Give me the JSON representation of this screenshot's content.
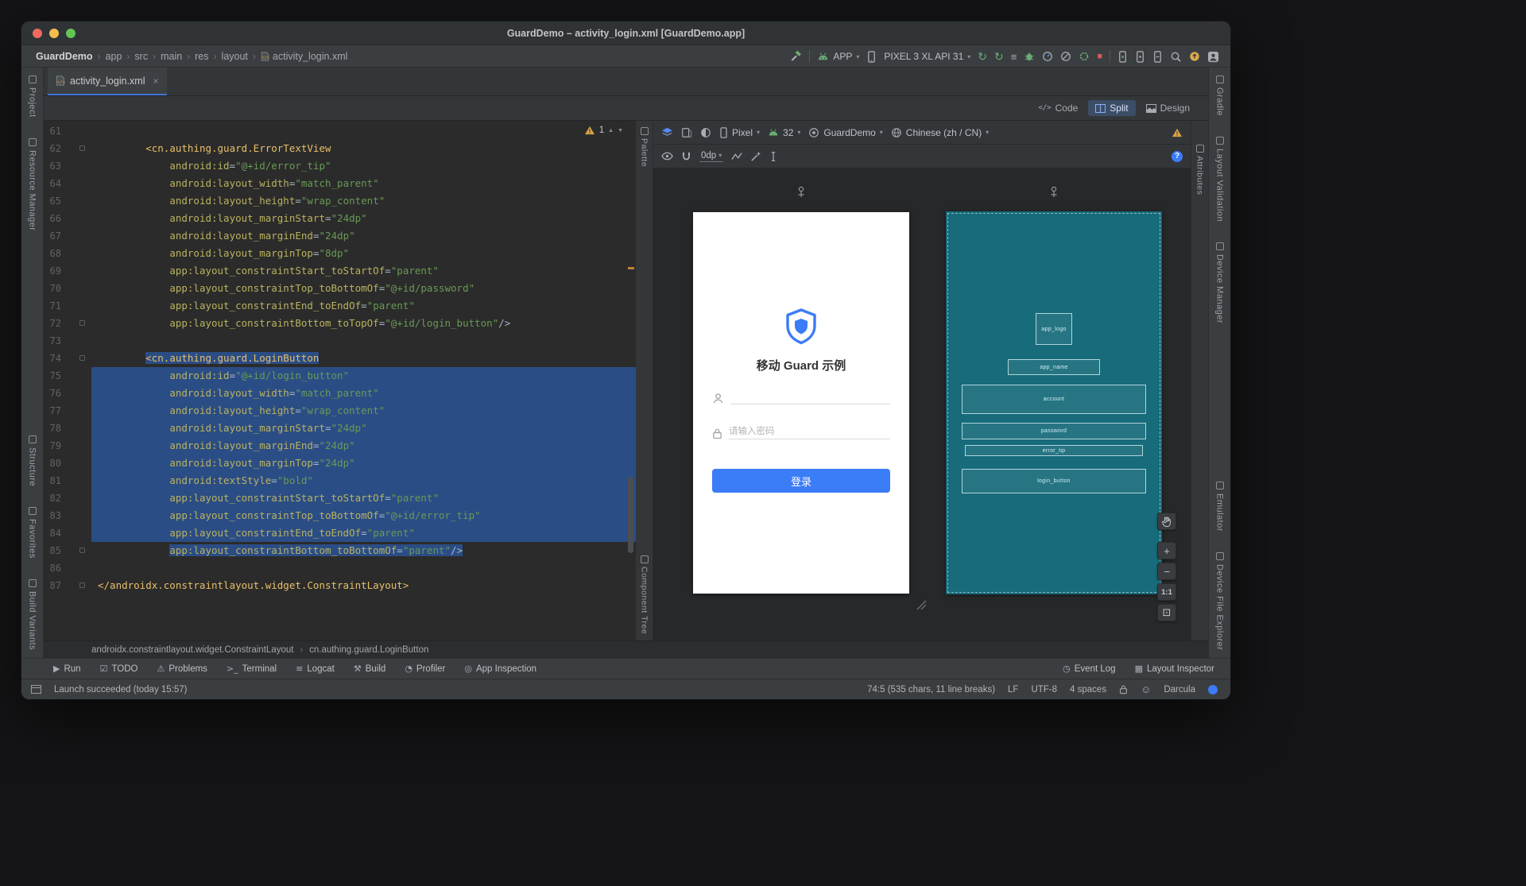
{
  "window": {
    "title": "GuardDemo – activity_login.xml [GuardDemo.app]"
  },
  "nav_breadcrumb": {
    "items": [
      "GuardDemo",
      "app",
      "src",
      "main",
      "res",
      "layout",
      "activity_login.xml"
    ]
  },
  "run_toolbar": {
    "config_label": "APP",
    "device_label": "PIXEL 3 XL API 31"
  },
  "left_stripe": {
    "top": [
      "Project",
      "Resource Manager"
    ],
    "bottom": [
      "Structure",
      "Favorites",
      "Build Variants"
    ]
  },
  "right_stripe": {
    "top": [
      "Gradle",
      "Layout Validation",
      "Device Manager"
    ],
    "bottom": [
      "Emulator",
      "Device File Explorer"
    ]
  },
  "editor": {
    "tab_title": "activity_login.xml",
    "modes": [
      "Code",
      "Split",
      "Design"
    ],
    "active_mode": "Split",
    "warning_count": "1"
  },
  "code": {
    "lines": [
      {
        "n": 61
      },
      {
        "n": 62,
        "ind": "        ",
        "m": 1,
        "seg": [
          [
            "t",
            "<cn.authing.guard.ErrorTextView"
          ]
        ]
      },
      {
        "n": 63,
        "ind": "            ",
        "seg": [
          [
            "a",
            "android:id"
          ],
          [
            "p",
            "="
          ],
          [
            "s",
            "\"@+id/error_tip\""
          ]
        ]
      },
      {
        "n": 64,
        "ind": "            ",
        "seg": [
          [
            "a",
            "android:layout_width"
          ],
          [
            "p",
            "="
          ],
          [
            "s",
            "\"match_parent\""
          ]
        ]
      },
      {
        "n": 65,
        "ind": "            ",
        "seg": [
          [
            "a",
            "android:layout_height"
          ],
          [
            "p",
            "="
          ],
          [
            "s",
            "\"wrap_content\""
          ]
        ]
      },
      {
        "n": 66,
        "ind": "            ",
        "seg": [
          [
            "a",
            "android:layout_marginStart"
          ],
          [
            "p",
            "="
          ],
          [
            "s",
            "\"24dp\""
          ]
        ]
      },
      {
        "n": 67,
        "ind": "            ",
        "seg": [
          [
            "a",
            "android:layout_marginEnd"
          ],
          [
            "p",
            "="
          ],
          [
            "s",
            "\"24dp\""
          ]
        ]
      },
      {
        "n": 68,
        "ind": "            ",
        "seg": [
          [
            "a",
            "android:layout_marginTop"
          ],
          [
            "p",
            "="
          ],
          [
            "s",
            "\"8dp\""
          ]
        ]
      },
      {
        "n": 69,
        "ind": "            ",
        "seg": [
          [
            "a",
            "app:layout_constraintStart_toStartOf"
          ],
          [
            "p",
            "="
          ],
          [
            "s",
            "\"parent\""
          ]
        ]
      },
      {
        "n": 70,
        "ind": "            ",
        "seg": [
          [
            "a",
            "app:layout_constraintTop_toBottomOf"
          ],
          [
            "p",
            "="
          ],
          [
            "s",
            "\"@+id/password\""
          ]
        ]
      },
      {
        "n": 71,
        "ind": "            ",
        "seg": [
          [
            "a",
            "app:layout_constraintEnd_toEndOf"
          ],
          [
            "p",
            "="
          ],
          [
            "s",
            "\"parent\""
          ]
        ]
      },
      {
        "n": 72,
        "ind": "            ",
        "m": 1,
        "seg": [
          [
            "a",
            "app:layout_constraintBottom_toTopOf"
          ],
          [
            "p",
            "="
          ],
          [
            "s",
            "\"@+id/login_button\""
          ],
          [
            "p",
            "/>"
          ]
        ]
      },
      {
        "n": 73
      },
      {
        "n": 74,
        "ind": "        ",
        "sel": "text",
        "m": 1,
        "seg": [
          [
            "t",
            "<cn.authing.guard.LoginButton"
          ]
        ]
      },
      {
        "n": 75,
        "ind": "            ",
        "sel": "full",
        "seg": [
          [
            "a",
            "android:id"
          ],
          [
            "p",
            "="
          ],
          [
            "s",
            "\"@+id/login_button\""
          ]
        ]
      },
      {
        "n": 76,
        "ind": "            ",
        "sel": "full",
        "seg": [
          [
            "a",
            "android:layout_width"
          ],
          [
            "p",
            "="
          ],
          [
            "s",
            "\"match_parent\""
          ]
        ]
      },
      {
        "n": 77,
        "ind": "            ",
        "sel": "full",
        "seg": [
          [
            "a",
            "android:layout_height"
          ],
          [
            "p",
            "="
          ],
          [
            "s",
            "\"wrap_content\""
          ]
        ]
      },
      {
        "n": 78,
        "ind": "            ",
        "sel": "full",
        "seg": [
          [
            "a",
            "android:layout_marginStart"
          ],
          [
            "p",
            "="
          ],
          [
            "s",
            "\"24dp\""
          ]
        ]
      },
      {
        "n": 79,
        "ind": "            ",
        "sel": "full",
        "seg": [
          [
            "a",
            "android:layout_marginEnd"
          ],
          [
            "p",
            "="
          ],
          [
            "s",
            "\"24dp\""
          ]
        ]
      },
      {
        "n": 80,
        "ind": "            ",
        "sel": "full",
        "seg": [
          [
            "a",
            "android:layout_marginTop"
          ],
          [
            "p",
            "="
          ],
          [
            "s",
            "\"24dp\""
          ]
        ]
      },
      {
        "n": 81,
        "ind": "            ",
        "sel": "full",
        "seg": [
          [
            "a",
            "android:textStyle"
          ],
          [
            "p",
            "="
          ],
          [
            "s",
            "\"bold\""
          ]
        ]
      },
      {
        "n": 82,
        "ind": "            ",
        "sel": "full",
        "seg": [
          [
            "a",
            "app:layout_constraintStart_toStartOf"
          ],
          [
            "p",
            "="
          ],
          [
            "s",
            "\"parent\""
          ]
        ]
      },
      {
        "n": 83,
        "ind": "            ",
        "sel": "full",
        "seg": [
          [
            "a",
            "app:layout_constraintTop_toBottomOf"
          ],
          [
            "p",
            "="
          ],
          [
            "s",
            "\"@+id/error_tip\""
          ]
        ]
      },
      {
        "n": 84,
        "ind": "            ",
        "sel": "full",
        "seg": [
          [
            "a",
            "app:layout_constraintEnd_toEndOf"
          ],
          [
            "p",
            "="
          ],
          [
            "s",
            "\"parent\""
          ]
        ]
      },
      {
        "n": 85,
        "ind": "            ",
        "sel": "text",
        "m": 1,
        "seg": [
          [
            "a",
            "app:layout_constraintBottom_toBottomOf"
          ],
          [
            "p",
            "="
          ],
          [
            "s",
            "\"parent\""
          ],
          [
            "p",
            "/>"
          ]
        ]
      },
      {
        "n": 86
      },
      {
        "n": 87,
        "m": 1,
        "seg": [
          [
            "t",
            "</androidx.constraintlayout.widget.ConstraintLayout>"
          ]
        ]
      }
    ]
  },
  "design_toolbar": {
    "device": "Pixel",
    "api": "32",
    "theme": "GuardDemo",
    "locale": "Chinese (zh / CN)",
    "margin": "0dp"
  },
  "design_tabs": {
    "palette": "Palette",
    "component_tree": "Component Tree",
    "attributes": "Attributes"
  },
  "preview": {
    "app_title": "移动 Guard 示例",
    "password_placeholder": "请输入密码",
    "login_button": "登录",
    "accent_color": "#3b7cf7"
  },
  "blueprint": {
    "labels": [
      "app_logo",
      "app_name",
      "account",
      "password",
      "error_tip",
      "login_button"
    ]
  },
  "zoom_controls": {
    "scale_label": "1:1"
  },
  "xml_breadcrumb": {
    "items": [
      "androidx.constraintlayout.widget.ConstraintLayout",
      "cn.authing.guard.LoginButton"
    ]
  },
  "bottom_bar": {
    "left": [
      {
        "label": "Run",
        "icon": "run-icon",
        "glyph": "▶"
      },
      {
        "label": "TODO",
        "icon": "todo-icon",
        "glyph": "☑"
      },
      {
        "label": "Problems",
        "icon": "problems-icon",
        "glyph": "⚠"
      },
      {
        "label": "Terminal",
        "icon": "terminal-icon",
        "glyph": ">_"
      },
      {
        "label": "Logcat",
        "icon": "logcat-icon",
        "glyph": "≡"
      },
      {
        "label": "Build",
        "icon": "build-hammer-icon",
        "glyph": "⚒"
      },
      {
        "label": "Profiler",
        "icon": "profiler-icon",
        "glyph": "◔"
      },
      {
        "label": "App Inspection",
        "icon": "app-inspection-icon",
        "glyph": "◎"
      }
    ],
    "right": [
      {
        "label": "Event Log",
        "icon": "event-log-icon",
        "glyph": "◷"
      },
      {
        "label": "Layout Inspector",
        "icon": "layout-inspector-icon",
        "glyph": "▦"
      }
    ]
  },
  "status_bar": {
    "message": "Launch succeeded (today 15:57)",
    "caret": "74:5 (535 chars, 11 line breaks)",
    "line_sep": "LF",
    "encoding": "UTF-8",
    "indent": "4 spaces",
    "theme": "Darcula"
  }
}
